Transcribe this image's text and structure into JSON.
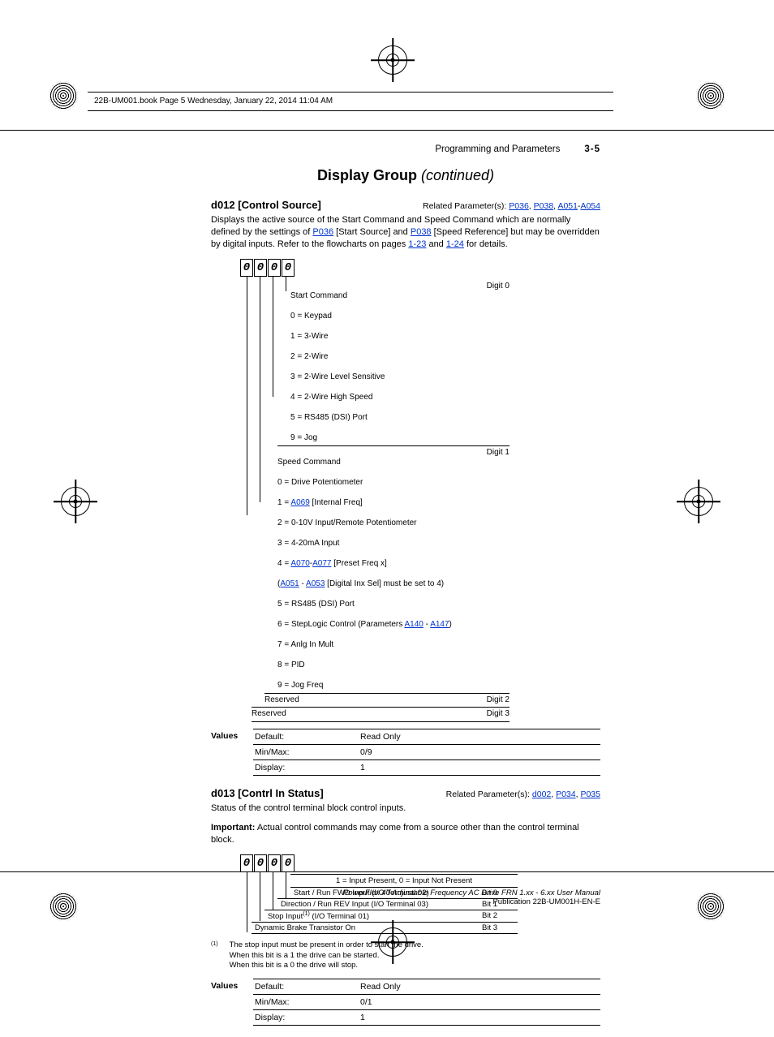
{
  "crop": {
    "header_strip": "22B-UM001.book  Page 5  Wednesday, January 22, 2014  11:04 AM"
  },
  "page_header": {
    "section": "Programming and Parameters",
    "page_num": "3-5"
  },
  "title_main": "Display Group",
  "title_cont": "(continued)",
  "d012": {
    "heading": "d012 [Control Source]",
    "related_label": "Related Parameter(s): ",
    "related_links": [
      "P036",
      "P038",
      "A051",
      "A054"
    ],
    "desc_pre": "Displays the active source of the Start Command and Speed Command which are normally defined by the settings of ",
    "desc_mid1_link": "P036",
    "desc_mid1_txt": " [Start Source] and ",
    "desc_mid2_link": "P038",
    "desc_mid2_txt": " [Speed Reference] but may be overridden by digital inputs. Refer to the flowcharts on pages ",
    "desc_pg1": "1-23",
    "desc_and": " and ",
    "desc_pg2": "1-24",
    "desc_end": " for details.",
    "digits": [
      "0",
      "0",
      "0",
      "0"
    ],
    "digit0": {
      "label": "Digit 0",
      "title": "Start Command",
      "lines": [
        "0 = Keypad",
        "1 = 3-Wire",
        "2 = 2-Wire",
        "3 = 2-Wire Level Sensitive",
        "4 = 2-Wire High Speed",
        "5 = RS485 (DSI) Port",
        "9 = Jog"
      ]
    },
    "digit1": {
      "label": "Digit 1",
      "title": "Speed Command",
      "l0": "0 = Drive Potentiometer",
      "l1_pre": "1 = ",
      "l1_link": "A069",
      "l1_post": " [Internal Freq]",
      "l2": "2 = 0-10V Input/Remote Potentiometer",
      "l3": "3 = 4-20mA Input",
      "l4_pre": "4 = ",
      "l4_link1": "A070",
      "l4_dash": "-",
      "l4_link2": "A077",
      "l4_post": " [Preset Freq x]",
      "l4b_pre": "      (",
      "l4b_link1": "A051",
      "l4b_mid": " - ",
      "l4b_link2": "A053",
      "l4b_post": " [Digital Inx Sel] must be set to 4)",
      "l5": "5 = RS485 (DSI) Port",
      "l6_pre": "6 = StepLogic Control (Parameters ",
      "l6_link1": "A140",
      "l6_mid": " - ",
      "l6_link2": "A147",
      "l6_post": ")",
      "l7": "7 = Anlg In Mult",
      "l8": "8 = PID",
      "l9": "9 = Jog Freq"
    },
    "digit2": {
      "label": "Digit 2",
      "title": "Reserved"
    },
    "digit3": {
      "label": "Digit 3",
      "title": "Reserved"
    },
    "values_label": "Values",
    "values": [
      {
        "k": "Default:",
        "v": "Read Only"
      },
      {
        "k": "Min/Max:",
        "v": "0/9"
      },
      {
        "k": "Display:",
        "v": "1"
      }
    ]
  },
  "d013": {
    "heading": "d013 [Contrl In Status]",
    "related_label": "Related Parameter(s): ",
    "related_links": [
      "d002",
      "P034",
      "P035"
    ],
    "status_desc": "Status of the control terminal block control inputs.",
    "important_label": "Important:",
    "important_text": " Actual control commands may come from a source other than the control terminal block.",
    "digits": [
      "0",
      "0",
      "0",
      "0"
    ],
    "legend": "1 = Input Present, 0 = Input Not Present",
    "bits": [
      {
        "t": "Start / Run FWD Input (I/O Terminal 02)",
        "b": "Bit 0"
      },
      {
        "t_pre": "Stop Input",
        "t_sup": "(1)",
        "t_post": " (I/O Terminal 01)",
        "t": "Direction / Run REV Input (I/O Terminal 03)",
        "b": "Bit 1"
      },
      {
        "t": "Stop Input(1) (I/O Terminal 01)",
        "b": "Bit 2"
      },
      {
        "t": "Dynamic Brake Transistor On",
        "b": "Bit 3"
      }
    ],
    "bit_rows": [
      {
        "t": "Start / Run FWD Input (I/O Terminal 02)",
        "b": "Bit 0",
        "sup": ""
      },
      {
        "t": "Direction / Run REV Input (I/O Terminal 03)",
        "b": "Bit 1",
        "sup": ""
      },
      {
        "t_pre": "Stop Input",
        "sup": "(1)",
        "t_post": " (I/O Terminal 01)",
        "b": "Bit 2"
      },
      {
        "t": "Dynamic Brake Transistor On",
        "b": "Bit 3",
        "sup": ""
      }
    ],
    "footnote_mark": "(1)",
    "footnote_body": "The stop input must be present in order to start the drive.\nWhen this bit is a 1 the drive can be started.\nWhen this bit is a 0 the drive will stop.",
    "values_label": "Values",
    "values": [
      {
        "k": "Default:",
        "v": "Read Only"
      },
      {
        "k": "Min/Max:",
        "v": "0/1"
      },
      {
        "k": "Display:",
        "v": "1"
      }
    ]
  },
  "footer": {
    "line1": "PowerFlex 40 Adjustable Frequency AC Drive FRN 1.xx - 6.xx User Manual",
    "line2": "Publication 22B-UM001H-EN-E"
  }
}
